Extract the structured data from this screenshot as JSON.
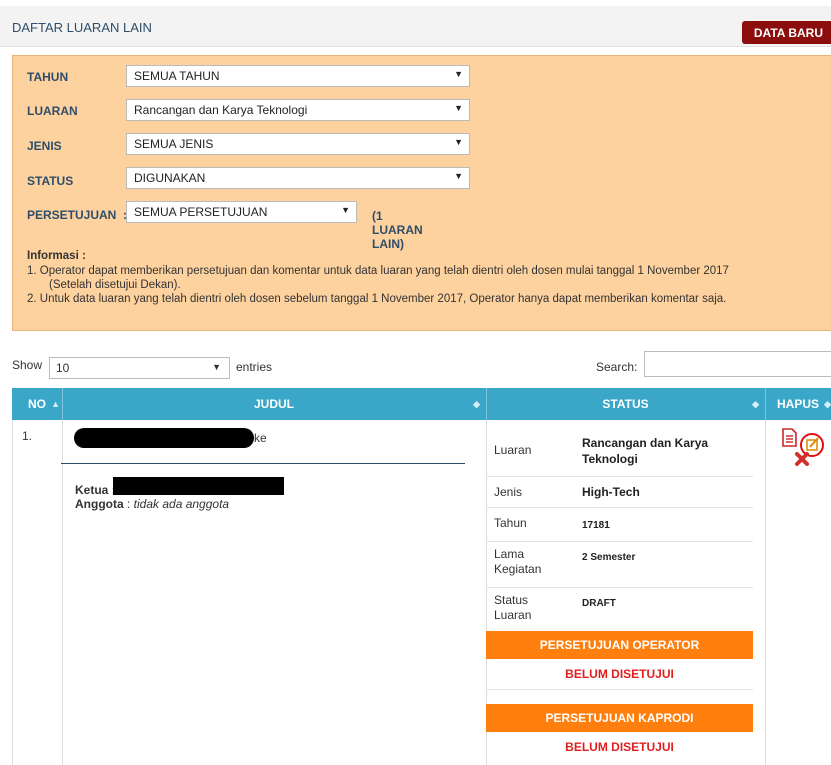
{
  "header": {
    "title": "DAFTAR LUARAN LAIN",
    "new_button": "DATA BARU"
  },
  "filters": {
    "tahun": {
      "label": "TAHUN",
      "value": "SEMUA TAHUN"
    },
    "luaran": {
      "label": "LUARAN",
      "value": "Rancangan dan Karya Teknologi"
    },
    "jenis": {
      "label": "JENIS",
      "value": "SEMUA JENIS"
    },
    "status": {
      "label": "STATUS",
      "value": "DIGUNAKAN"
    },
    "persetujuan": {
      "label": "PERSETUJUAN",
      "value": "SEMUA PERSETUJUAN"
    },
    "count_text": "(1 LUARAN LAIN)"
  },
  "info": {
    "title": "Informasi :",
    "item1": "1. Operator dapat memberikan persetujuan dan komentar untuk data luaran yang telah dientri oleh dosen mulai tanggal 1 November 2017",
    "item1_cont": "(Setelah disetujui Dekan).",
    "item2": "2. Untuk data luaran yang telah dientri oleh dosen sebelum tanggal 1 November 2017, Operator hanya dapat memberikan komentar saja."
  },
  "table_controls": {
    "show": "Show",
    "entries_value": "10",
    "entries": "entries",
    "search": "Search:"
  },
  "columns": {
    "no": "NO",
    "judul": "JUDUL",
    "status": "STATUS",
    "hapus": "HAPUS"
  },
  "row": {
    "no": "1.",
    "title_suffix": "ke",
    "ketua_label": "Ketua",
    "anggota_label": "Anggota",
    "anggota_value": "tidak ada anggota",
    "status": {
      "luaran_label": "Luaran",
      "luaran_value": "Rancangan dan Karya Teknologi",
      "jenis_label": "Jenis",
      "jenis_value": "High-Tech",
      "tahun_label": "Tahun",
      "tahun_value": "17181",
      "lama_label": "Lama Kegiatan",
      "lama_value": "2 Semester",
      "status_label": "Status Luaran",
      "status_value": "DRAFT"
    },
    "approval_operator": {
      "title": "PERSETUJUAN OPERATOR",
      "value": "BELUM DISETUJUI"
    },
    "approval_kaprodi": {
      "title": "PERSETUJUAN KAPRODI",
      "value": "BELUM DISETUJUI"
    }
  },
  "icons": [
    "document-icon",
    "edit-icon",
    "delete-icon"
  ],
  "colors": {
    "table_header": "#3aa6c8",
    "approval_orange": "#ff7f0e",
    "approval_red": "#e02020",
    "new_button": "#8b0d0d",
    "filter_bg": "#fdd29e"
  }
}
